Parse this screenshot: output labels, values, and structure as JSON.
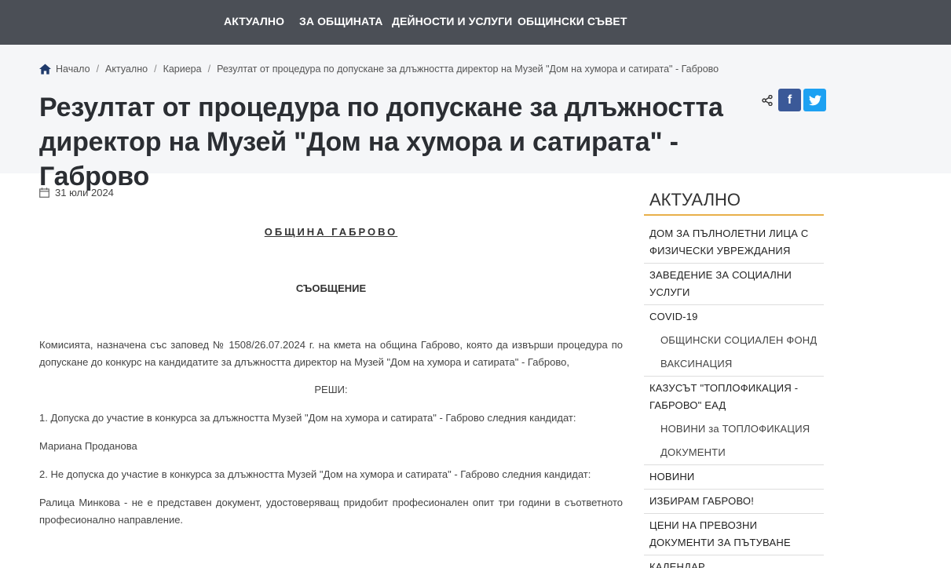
{
  "nav": {
    "items": [
      "АКТУАЛНО",
      "ЗА ОБЩИНАТА",
      "ДЕЙНОСТИ И УСЛУГИ",
      "ОБЩИНСКИ СЪВЕТ"
    ]
  },
  "breadcrumb": {
    "home": "Начало",
    "items": [
      "Актуално",
      "Кариера"
    ],
    "current": "Резултат от процедура по допускане за длъжността директор на Музей \"Дом на хумора и сатирата\" - Габрово"
  },
  "page": {
    "title": "Резултат от процедура по допускане за длъжността директор на Музей \"Дом на хумора и сатирата\" - Габрово",
    "date": "31 юли 2024"
  },
  "share": {
    "facebook_glyph": "f",
    "twitter_glyph": "t"
  },
  "article": {
    "org": "ОБЩИНА ГАБРОВО",
    "heading": "СЪОБЩЕНИЕ",
    "intro": "Комисията, назначена със заповед № 1508/26.07.2024 г. на кмета на община Габрово, която да извърши процедура по допускане до конкурс на кандидатите за длъжността директор на Музей \"Дом на хумора и сатирата\" - Габрово,",
    "decides": "РЕШИ:",
    "point1": "1. Допуска до участие в конкурса за длъжността Музей \"Дом на хумора и сатирата\" - Габрово следния кандидат:",
    "candidate1": "Мариана Проданова",
    "point2": "2. Не допуска до участие в конкурса за длъжността Музей \"Дом на хумора и сатирата\" - Габрово следния кандидат:",
    "candidate2": "Ралица Минкова - не е представен документ, удостоверяващ придобит професионален опит три години в съответното професионално направление."
  },
  "sidebar": {
    "title": "АКТУАЛНО",
    "items": [
      {
        "label": "ДОМ ЗА ПЪЛНОЛЕТНИ ЛИЦА С ФИЗИЧЕСКИ УВРЕЖДАНИЯ",
        "sub": false
      },
      {
        "label": "ЗАВЕДЕНИЕ ЗА СОЦИАЛНИ УСЛУГИ",
        "sub": false
      },
      {
        "label": "COVID-19",
        "sub": false
      },
      {
        "label": "ОБЩИНСКИ СОЦИАЛЕН ФОНД",
        "sub": true
      },
      {
        "label": "ВАКСИНАЦИЯ",
        "sub": true
      },
      {
        "label": "КАЗУСЪТ \"ТОПЛОФИКАЦИЯ - ГАБРОВО\" ЕАД",
        "sub": false
      },
      {
        "label": "НОВИНИ за ТОПЛОФИКАЦИЯ",
        "sub": true
      },
      {
        "label": "ДОКУМЕНТИ",
        "sub": true
      },
      {
        "label": "НОВИНИ",
        "sub": false
      },
      {
        "label": "ИЗБИРАМ ГАБРОВО!",
        "sub": false
      },
      {
        "label": "ЦЕНИ НА ПРЕВОЗНИ ДОКУМЕНТИ ЗА ПЪТУВАНЕ",
        "sub": false
      },
      {
        "label": "КАЛЕНДАР",
        "sub": false
      }
    ]
  },
  "colors": {
    "nav_bg": "#4b4f56",
    "hero_bg": "#f5f6f8",
    "accent": "#e8b04a",
    "facebook": "#3b5998",
    "twitter": "#1da1f2",
    "home_icon": "#1f3a6b"
  },
  "icons": {
    "home": "home-icon",
    "share": "share-icon",
    "calendar": "calendar-icon"
  }
}
